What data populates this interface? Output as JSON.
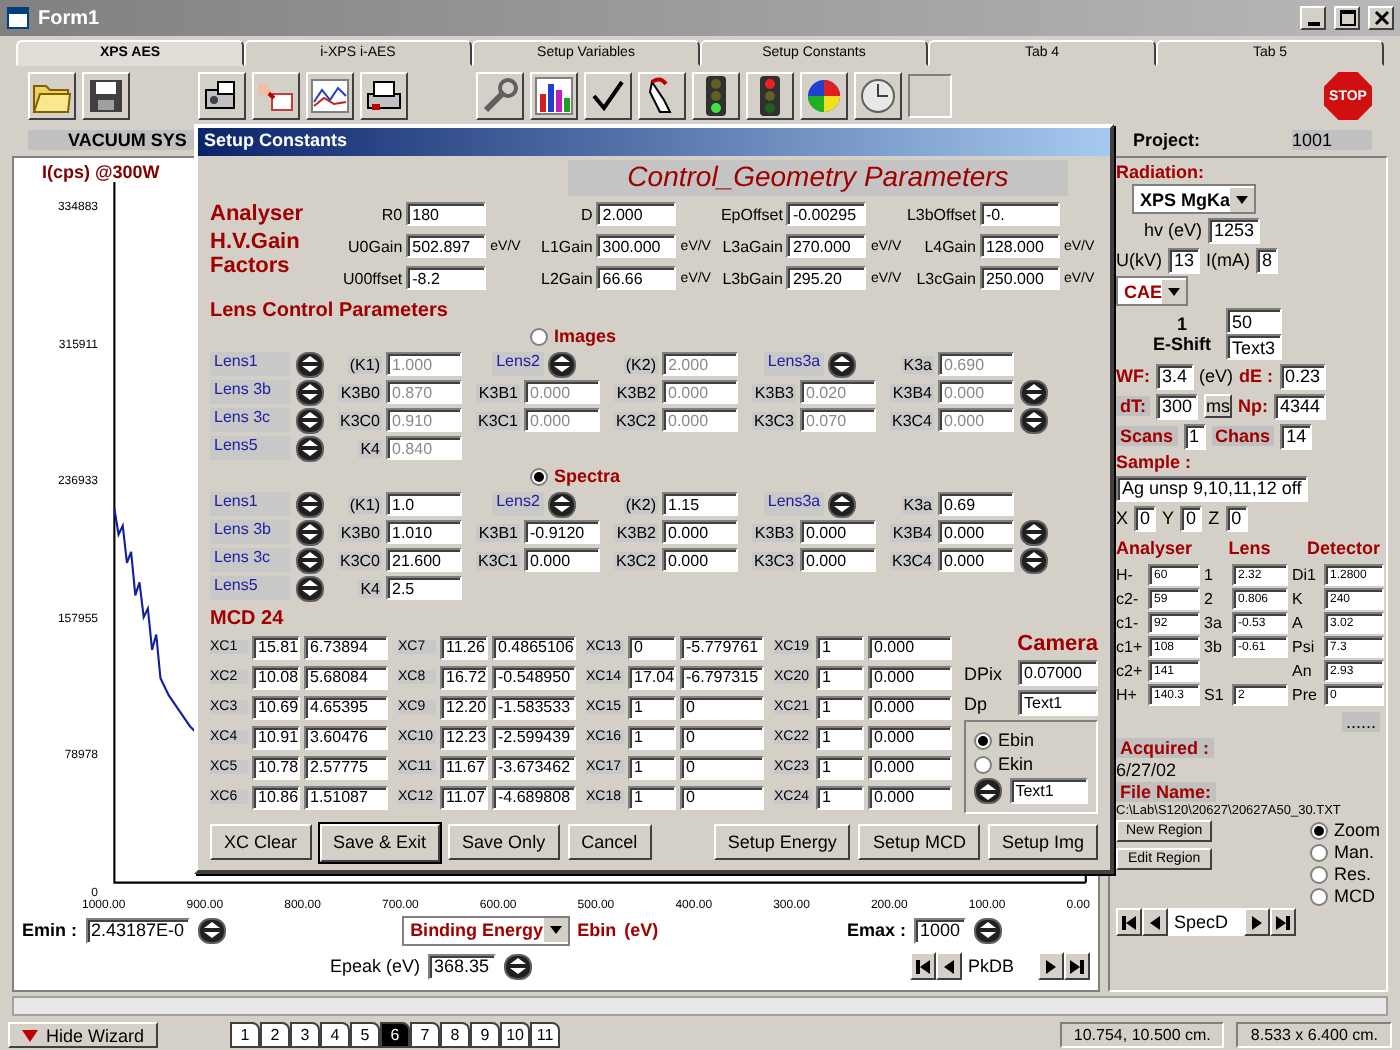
{
  "window": {
    "title": "Form1"
  },
  "tabs": [
    {
      "label": "XPS AES",
      "selected": true
    },
    {
      "label": "i-XPS i-AES",
      "selected": false
    },
    {
      "label": "Setup Variables",
      "selected": false
    },
    {
      "label": "Setup Constants",
      "selected": false
    },
    {
      "label": "Tab 4",
      "selected": false
    },
    {
      "label": "Tab 5",
      "selected": false
    }
  ],
  "toolbar": {
    "stop_label": "STOP"
  },
  "status_row": {
    "vacuum": "VACUUM SYS",
    "project_label": "Project:",
    "project_value": "1001"
  },
  "chart": {
    "ylabel": "I(cps) @300W",
    "y_tick_labels": [
      "334883",
      "315911",
      "236933",
      "157955",
      "78978",
      "0"
    ],
    "x_tick_labels": [
      "1000.00",
      "900.00",
      "800.00",
      "700.00",
      "600.00",
      "500.00",
      "400.00",
      "300.00",
      "200.00",
      "100.00",
      "0.00"
    ]
  },
  "energy_controls": {
    "emin_label": "Emin :",
    "emin": "2.43187E-0",
    "mode": "Binding Energy",
    "ebin": "Ebin",
    "ebin_unit": "(eV)",
    "emax_label": "Emax :",
    "emax": "1000",
    "epeak_label": "Epeak (eV)",
    "epeak": "368.35",
    "nav": "PkDB"
  },
  "dialog": {
    "title": "Setup Constants",
    "heading": "Control_Geometry Parameters",
    "analyser_label": "Analyser",
    "gain_label": "H.V.Gain Factors",
    "params": [
      [
        {
          "label": "R0",
          "value": "180"
        },
        {
          "label": "D",
          "value": "2.000"
        },
        {
          "label": "EpOffset",
          "value": "-0.00295"
        },
        {
          "label": "L3bOffset",
          "value": "-0."
        }
      ],
      [
        {
          "label": "U0Gain",
          "value": "502.897",
          "unit": "eV/V"
        },
        {
          "label": "L1Gain",
          "value": "300.000",
          "unit": "eV/V"
        },
        {
          "label": "L3aGain",
          "value": "270.000",
          "unit": "eV/V"
        },
        {
          "label": "L4Gain",
          "value": "128.000",
          "unit": "eV/V"
        }
      ],
      [
        {
          "label": "U00ffset",
          "value": "-8.2"
        },
        {
          "label": "L2Gain",
          "value": "66.66",
          "unit": "eV/V"
        },
        {
          "label": "L3bGain",
          "value": "295.20",
          "unit": "eV/V"
        },
        {
          "label": "L3cGain",
          "value": "250.000",
          "unit": "eV/V"
        }
      ]
    ],
    "lens_title": "Lens Control Parameters",
    "lens_groups": [
      {
        "radio": "Images",
        "selected": false,
        "disabled": true,
        "rows": [
          [
            {
              "kind": "lens",
              "label": "Lens1"
            },
            {
              "kind": "spin"
            },
            {
              "kind": "field",
              "label": "(K1)",
              "value": "1.000"
            },
            {
              "kind": "lens_spin",
              "label": "Lens2"
            },
            {
              "kind": "field",
              "label": "(K2)",
              "value": "2.000"
            },
            {
              "kind": "lens_spin",
              "label": "Lens3a"
            },
            {
              "kind": "field",
              "label": "K3a",
              "value": "0.690"
            }
          ],
          [
            {
              "kind": "lens",
              "label": "Lens 3b"
            },
            {
              "kind": "spin"
            },
            {
              "kind": "field",
              "label": "K3B0",
              "value": "0.870"
            },
            {
              "kind": "field",
              "label": "K3B1",
              "value": "0.000"
            },
            {
              "kind": "field",
              "label": "K3B2",
              "value": "0.000"
            },
            {
              "kind": "field",
              "label": "K3B3",
              "value": "0.020"
            },
            {
              "kind": "field",
              "label": "K3B4",
              "value": "0.000"
            },
            {
              "kind": "spin"
            }
          ],
          [
            {
              "kind": "lens",
              "label": "Lens 3c"
            },
            {
              "kind": "spin"
            },
            {
              "kind": "field",
              "label": "K3C0",
              "value": "0.910"
            },
            {
              "kind": "field",
              "label": "K3C1",
              "value": "0.000"
            },
            {
              "kind": "field",
              "label": "K3C2",
              "value": "0.000"
            },
            {
              "kind": "field",
              "label": "K3C3",
              "value": "0.070"
            },
            {
              "kind": "field",
              "label": "K3C4",
              "value": "0.000"
            },
            {
              "kind": "spin"
            }
          ],
          [
            {
              "kind": "lens",
              "label": "Lens5"
            },
            {
              "kind": "spin"
            },
            {
              "kind": "field",
              "label": "K4",
              "value": "0.840"
            }
          ]
        ]
      },
      {
        "radio": "Spectra",
        "selected": true,
        "disabled": false,
        "rows": [
          [
            {
              "kind": "lens",
              "label": "Lens1"
            },
            {
              "kind": "spin"
            },
            {
              "kind": "field",
              "label": "(K1)",
              "value": "1.0"
            },
            {
              "kind": "lens_spin",
              "label": "Lens2"
            },
            {
              "kind": "field",
              "label": "(K2)",
              "value": "1.15"
            },
            {
              "kind": "lens_spin",
              "label": "Lens3a"
            },
            {
              "kind": "field",
              "label": "K3a",
              "value": "0.69"
            }
          ],
          [
            {
              "kind": "lens",
              "label": "Lens 3b"
            },
            {
              "kind": "spin"
            },
            {
              "kind": "field",
              "label": "K3B0",
              "value": "1.010"
            },
            {
              "kind": "field",
              "label": "K3B1",
              "value": "-0.9120"
            },
            {
              "kind": "field",
              "label": "K3B2",
              "value": "0.000"
            },
            {
              "kind": "field",
              "label": "K3B3",
              "value": "0.000"
            },
            {
              "kind": "field",
              "label": "K3B4",
              "value": "0.000"
            },
            {
              "kind": "spin"
            }
          ],
          [
            {
              "kind": "lens",
              "label": "Lens 3c"
            },
            {
              "kind": "spin"
            },
            {
              "kind": "field",
              "label": "K3C0",
              "value": "21.600"
            },
            {
              "kind": "field",
              "label": "K3C1",
              "value": "0.000"
            },
            {
              "kind": "field",
              "label": "K3C2",
              "value": "0.000"
            },
            {
              "kind": "field",
              "label": "K3C3",
              "value": "0.000"
            },
            {
              "kind": "field",
              "label": "K3C4",
              "value": "0.000"
            },
            {
              "kind": "spin"
            }
          ],
          [
            {
              "kind": "lens",
              "label": "Lens5"
            },
            {
              "kind": "spin"
            },
            {
              "kind": "field",
              "label": "K4",
              "value": "2.5"
            }
          ]
        ]
      }
    ],
    "mcd_title": "MCD 24",
    "xc": [
      {
        "label": "XC1",
        "a": "15.81",
        "b": "6.73894"
      },
      {
        "label": "XC2",
        "a": "10.08",
        "b": "5.68084"
      },
      {
        "label": "XC3",
        "a": "10.69",
        "b": "4.65395"
      },
      {
        "label": "XC4",
        "a": "10.91",
        "b": "3.60476"
      },
      {
        "label": "XC5",
        "a": "10.78",
        "b": "2.57775"
      },
      {
        "label": "XC6",
        "a": "10.86",
        "b": "1.51087"
      },
      {
        "label": "XC7",
        "a": "11.26",
        "b": "0.4865106"
      },
      {
        "label": "XC8",
        "a": "16.72",
        "b": "-0.548950"
      },
      {
        "label": "XC9",
        "a": "12.20",
        "b": "-1.583533"
      },
      {
        "label": "XC10",
        "a": "12.23",
        "b": "-2.599439"
      },
      {
        "label": "XC11",
        "a": "11.67",
        "b": "-3.673462"
      },
      {
        "label": "XC12",
        "a": "11.07",
        "b": "-4.689808"
      },
      {
        "label": "XC13",
        "a": "0",
        "b": "-5.779761"
      },
      {
        "label": "XC14",
        "a": "17.04",
        "b": "-6.797315"
      },
      {
        "label": "XC15",
        "a": "1",
        "b": "0"
      },
      {
        "label": "XC16",
        "a": "1",
        "b": "0"
      },
      {
        "label": "XC17",
        "a": "1",
        "b": "0"
      },
      {
        "label": "XC18",
        "a": "1",
        "b": "0"
      },
      {
        "label": "XC19",
        "a": "1",
        "b": "0.000"
      },
      {
        "label": "XC20",
        "a": "1",
        "b": "0.000"
      },
      {
        "label": "XC21",
        "a": "1",
        "b": "0.000"
      },
      {
        "label": "XC22",
        "a": "1",
        "b": "0.000"
      },
      {
        "label": "XC23",
        "a": "1",
        "b": "0.000"
      },
      {
        "label": "XC24",
        "a": "1",
        "b": "0.000"
      }
    ],
    "camera": {
      "title": "Camera",
      "dpix_label": "DPix",
      "dpix": "0.07000",
      "dp_label": "Dp",
      "dp": "Text1",
      "radios": [
        {
          "label": "Ebin",
          "selected": true
        },
        {
          "label": "Ekin",
          "selected": false
        }
      ],
      "text": "Text1"
    },
    "buttons": [
      {
        "label": "XC Clear",
        "default": false
      },
      {
        "label": "Save & Exit",
        "default": true
      },
      {
        "label": "Save Only",
        "default": false
      },
      {
        "label": "Cancel",
        "default": false
      },
      {
        "label": "Setup Energy",
        "default": false
      },
      {
        "label": "Setup MCD",
        "default": false
      },
      {
        "label": "Setup Img",
        "default": false
      }
    ]
  },
  "side": {
    "radiation_label": "Radiation:",
    "source": "XPS MgKa",
    "hv_label": "hv (eV)",
    "hv": "1253",
    "u_label": "U(kV)",
    "u": "13",
    "i_label": "I(mA)",
    "i": "8",
    "mode": "CAE",
    "mode_value_label": "1",
    "eshift_label": "E-Shift",
    "mode_value": "50",
    "eshift": "Text3",
    "wf_label": "WF:",
    "wf": "3.4",
    "ev": "(eV)",
    "de_label": "dE :",
    "de": "0.23",
    "dt_label": "dT:",
    "dt": "300",
    "ms": "ms",
    "np_label": "Np:",
    "np": "4344",
    "scans_label": "Scans",
    "scans": "1",
    "chans_label": "Chans",
    "chans": "14",
    "sample_label": "Sample :",
    "sample": "Ag unsp 9,10,11,12 off",
    "coords": [
      {
        "label": "X",
        "value": "0"
      },
      {
        "label": "Y",
        "value": "0"
      },
      {
        "label": "Z",
        "value": "0"
      }
    ],
    "table_headers": [
      "Analyser",
      "Lens",
      "Detector"
    ],
    "table_rows": [
      {
        "analyser": {
          "label": "H-",
          "value": "60"
        },
        "lens": {
          "label": "1",
          "value": "2.32"
        },
        "detector": {
          "label": "Di1",
          "value": "1.2800"
        }
      },
      {
        "analyser": {
          "label": "c2-",
          "value": "59"
        },
        "lens": {
          "label": "2",
          "value": "0.806"
        },
        "detector": {
          "label": "K",
          "value": "240"
        }
      },
      {
        "analyser": {
          "label": "c1-",
          "value": "92"
        },
        "lens": {
          "label": "3a",
          "value": "-0.53"
        },
        "detector": {
          "label": "A",
          "value": "3.02"
        }
      },
      {
        "analyser": {
          "label": "c1+",
          "value": "108"
        },
        "lens": {
          "label": "3b",
          "value": "-0.61"
        },
        "detector": {
          "label": "Psi",
          "value": "7.3"
        }
      },
      {
        "analyser": {
          "label": "c2+",
          "value": "141"
        },
        "detector": {
          "label": "An",
          "value": "2.93"
        }
      },
      {
        "analyser": {
          "label": "H+",
          "value": "140.3"
        },
        "lens": {
          "label": "S1",
          "value": "2"
        },
        "detector": {
          "label": "Pre",
          "value": "0"
        }
      }
    ],
    "dots": "......",
    "acquired_label": "Acquired :",
    "acquired": "6/27/02",
    "file_label": "File Name:",
    "file": "C:\\Lab\\S120\\20627\\20627A50_30.TXT",
    "region_buttons": [
      "New Region",
      "Edit Region"
    ],
    "view_radios": [
      {
        "label": "Zoom",
        "selected": true
      },
      {
        "label": "Man.",
        "selected": false
      }
    ],
    "calc_radios": [
      {
        "label": "Res.",
        "selected": false
      },
      {
        "label": "MCD",
        "selected": false
      }
    ],
    "nav": "SpecD"
  },
  "footer": {
    "wizard": "Hide Wizard",
    "pages": [
      {
        "label": "1",
        "selected": false
      },
      {
        "label": "2",
        "selected": false
      },
      {
        "label": "3",
        "selected": false
      },
      {
        "label": "4",
        "selected": false
      },
      {
        "label": "5",
        "selected": false
      },
      {
        "label": "6",
        "selected": true
      },
      {
        "label": "7",
        "selected": false
      },
      {
        "label": "8",
        "selected": false
      },
      {
        "label": "9",
        "selected": false
      },
      {
        "label": "10",
        "selected": false
      },
      {
        "label": "11",
        "selected": false
      }
    ],
    "cursor": "10.754, 10.500 cm.",
    "size": "8.533 x 6.400 cm."
  }
}
